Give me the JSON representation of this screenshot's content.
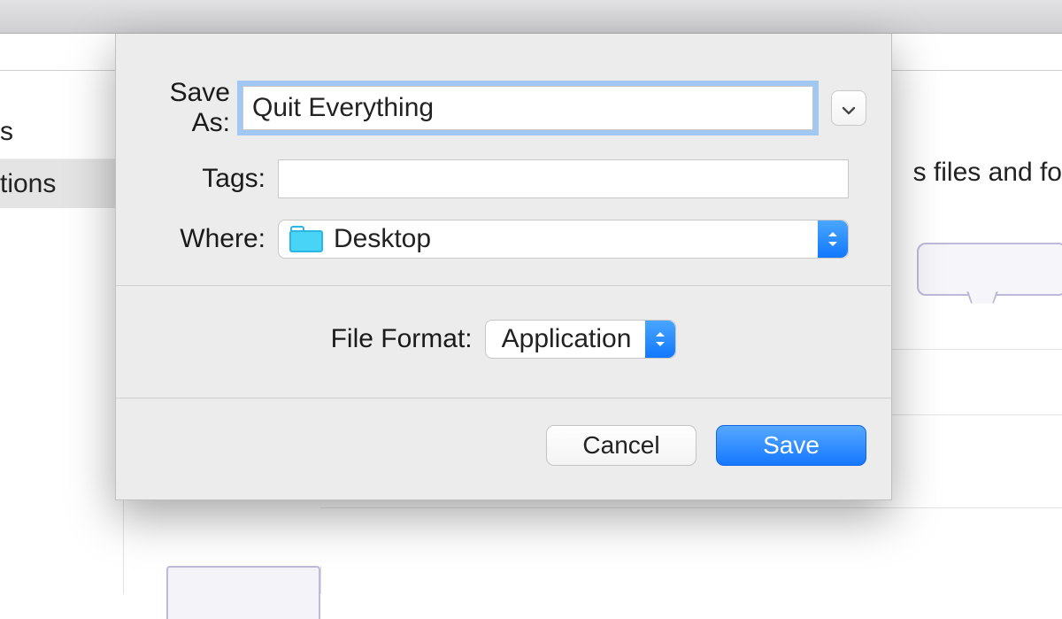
{
  "background": {
    "sidebar": {
      "item1_label": "s",
      "item2_label": "tions"
    },
    "hint_text": "s files and fo"
  },
  "dialog": {
    "saveas_label": "Save As:",
    "saveas_value": "Quit Everything",
    "tags_label": "Tags:",
    "tags_value": "",
    "where_label": "Where:",
    "where_value": "Desktop",
    "format_label": "File Format:",
    "format_value": "Application",
    "cancel_label": "Cancel",
    "save_label": "Save"
  }
}
